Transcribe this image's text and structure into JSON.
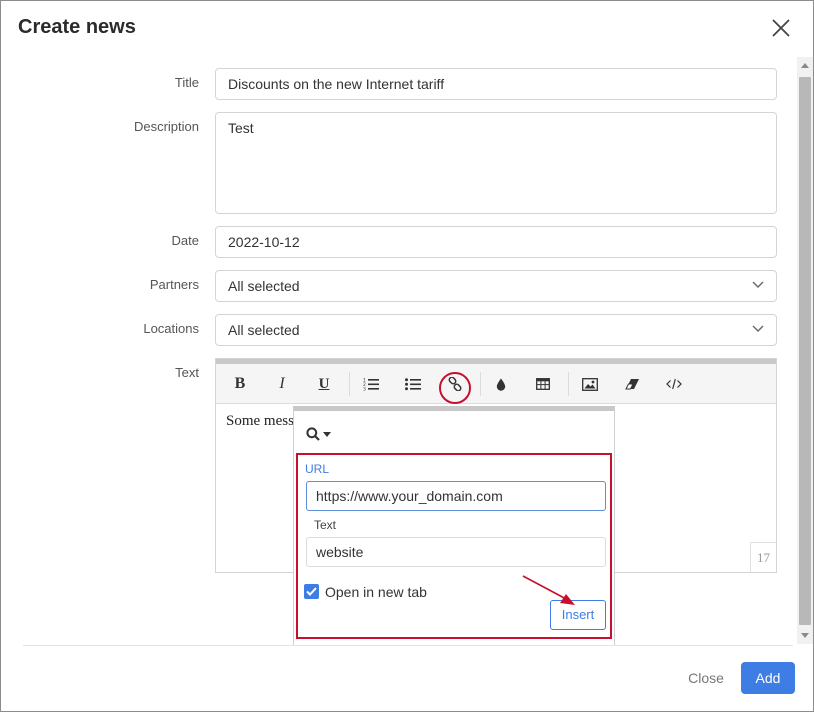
{
  "dialog": {
    "title": "Create news"
  },
  "form": {
    "title_label": "Title",
    "title_value": "Discounts on the new Internet tariff",
    "description_label": "Description",
    "description_value": "Test",
    "date_label": "Date",
    "date_value": "2022-10-12",
    "partners_label": "Partners",
    "partners_value": "All selected",
    "locations_label": "Locations",
    "locations_value": "All selected",
    "text_label": "Text"
  },
  "editor": {
    "content": "Some message",
    "char_count": "17",
    "toolbar": [
      "bold",
      "italic",
      "underline",
      "ordered-list",
      "unordered-list",
      "link",
      "color",
      "table",
      "image",
      "eraser",
      "code-view"
    ]
  },
  "link_popup": {
    "url_label": "URL",
    "url_value": "https://www.your_domain.com",
    "text_label": "Text",
    "text_value": "website",
    "new_tab_label": "Open in new tab",
    "new_tab_checked": true,
    "insert_label": "Insert"
  },
  "footer": {
    "close_label": "Close",
    "add_label": "Add"
  },
  "colors": {
    "accent": "#3d7de4",
    "highlight": "#c8102e"
  }
}
